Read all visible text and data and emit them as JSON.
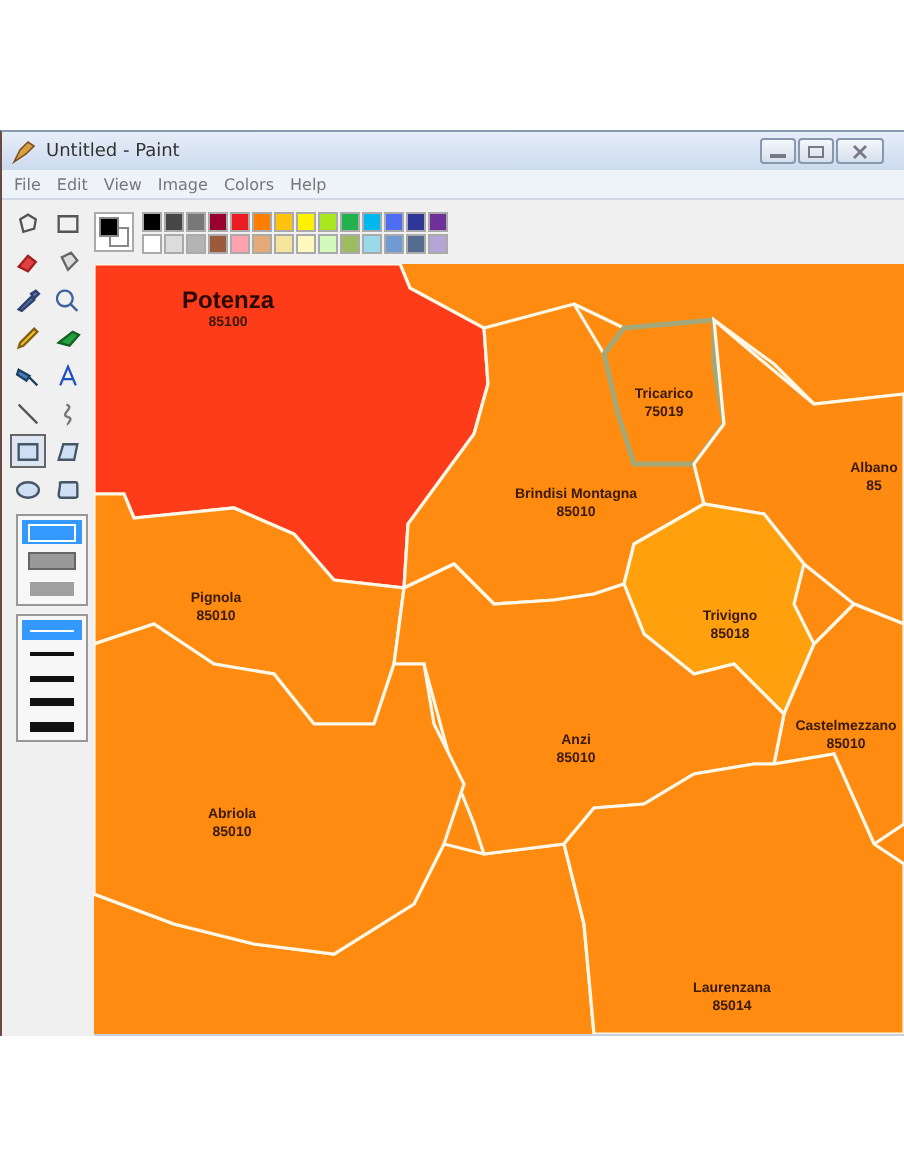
{
  "window": {
    "title": "Untitled - Paint"
  },
  "menu": [
    "File",
    "Edit",
    "View",
    "Image",
    "Colors",
    "Help"
  ],
  "tools": [
    {
      "selected": false
    },
    {
      "selected": false
    },
    {
      "selected": false
    },
    {
      "selected": false
    },
    {
      "selected": false
    },
    {
      "selected": false
    },
    {
      "selected": false
    },
    {
      "selected": false
    },
    {
      "selected": false
    },
    {
      "selected": false
    },
    {
      "selected": false
    },
    {
      "selected": false
    },
    {
      "selected": true
    },
    {
      "selected": false
    },
    {
      "selected": false
    },
    {
      "selected": false
    }
  ],
  "fill_styles": [
    {
      "selected": true
    },
    {
      "selected": false
    },
    {
      "selected": false
    }
  ],
  "line_widths": [
    {
      "selected": true
    },
    {
      "selected": false
    },
    {
      "selected": false
    },
    {
      "selected": false
    },
    {
      "selected": false
    }
  ],
  "palette": [
    {
      "color": "#000000"
    },
    {
      "color": "#464646"
    },
    {
      "color": "#787878"
    },
    {
      "color": "#990030"
    },
    {
      "color": "#ed1c24"
    },
    {
      "color": "#ff7e00"
    },
    {
      "color": "#ffc20e"
    },
    {
      "color": "#fff200"
    },
    {
      "color": "#a8e61d"
    },
    {
      "color": "#22b14c"
    },
    {
      "color": "#00b7ef"
    },
    {
      "color": "#4d6df3"
    },
    {
      "color": "#2f3699"
    },
    {
      "color": "#6f3198"
    },
    {
      "color": "#ffffff"
    },
    {
      "color": "#dcdcdc"
    },
    {
      "color": "#b4b4b4"
    },
    {
      "color": "#9c5a3c"
    },
    {
      "color": "#ffa3b1"
    },
    {
      "color": "#e5aa7a"
    },
    {
      "color": "#f5e49c"
    },
    {
      "color": "#fff9bd"
    },
    {
      "color": "#d3f9bc"
    },
    {
      "color": "#9dbb61"
    },
    {
      "color": "#99d9ea"
    },
    {
      "color": "#709ad1"
    },
    {
      "color": "#546d8e"
    },
    {
      "color": "#b5a5d5"
    }
  ],
  "regions": [
    {
      "name": "Potenza",
      "code": "85100",
      "color": "#ff3c1a",
      "highlighted": false
    },
    {
      "name": "Brindisi Montagna",
      "code": "85010",
      "color": "#ff8c10",
      "highlighted": false
    },
    {
      "name": "Tricarico",
      "code": "75019",
      "color": "#ff8c10",
      "highlighted": true
    },
    {
      "name": "Albano",
      "code": "85",
      "color": "#ff8a12",
      "highlighted": false
    },
    {
      "name": "Pignola",
      "code": "85010",
      "color": "#ff8c10",
      "highlighted": false
    },
    {
      "name": "Trivigno",
      "code": "85018",
      "color": "#ffa00c",
      "highlighted": false
    },
    {
      "name": "Castelmezzano",
      "code": "85010",
      "color": "#ff8c10",
      "highlighted": false
    },
    {
      "name": "Anzi",
      "code": "85010",
      "color": "#ff8c10",
      "highlighted": false
    },
    {
      "name": "Abriola",
      "code": "85010",
      "color": "#ff8c10",
      "highlighted": false
    },
    {
      "name": "Laurenzana",
      "code": "85014",
      "color": "#ff8c10",
      "highlighted": false
    }
  ]
}
